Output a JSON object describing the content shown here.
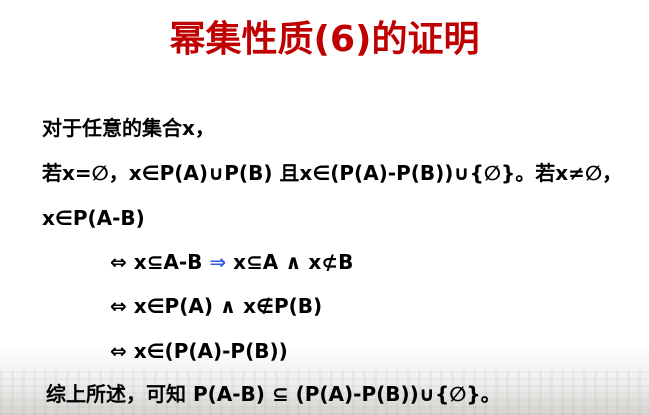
{
  "slide": {
    "title": "幂集性质(6)的证明",
    "lines": [
      "对于任意的集合x，",
      "若x=∅，x∈P(A)∪P(B) 且x∈(P(A)-P(B))∪{∅}。若x≠∅，",
      "x∈P(A-B)"
    ],
    "step1": {
      "before": "⇔ x⊆A-B ",
      "arrow": "⇒",
      "after": " x⊆A ∧ x⊄B"
    },
    "step2": "⇔ x∈P(A) ∧ x∉P(B)",
    "step3": "⇔ x∈(P(A)-P(B))",
    "conclusion": "综上所述，可知 P(A-B) ⊆ (P(A)-P(B))∪{∅}。"
  },
  "colors": {
    "title": "#c00000",
    "arrow": "#2e5fd6",
    "text": "#000000"
  }
}
